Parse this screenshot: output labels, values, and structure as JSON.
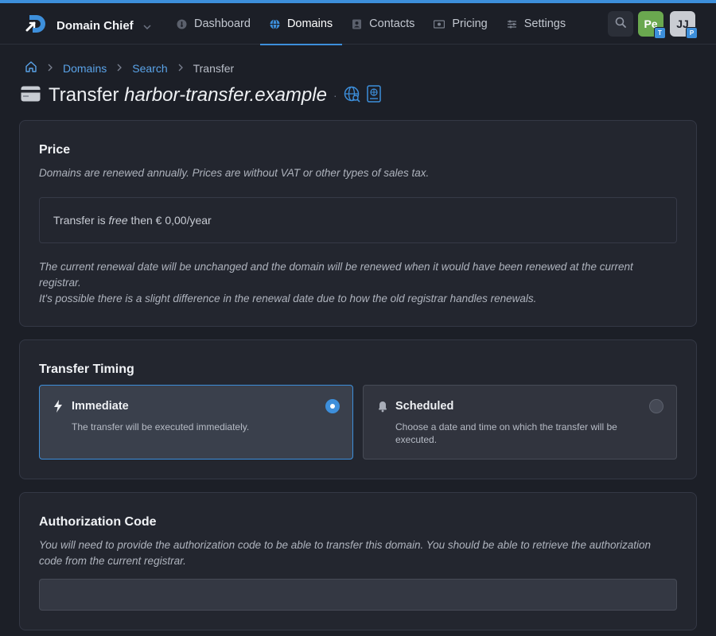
{
  "app": {
    "name": "Domain Chief",
    "accent": "#3d8fdb"
  },
  "nav": {
    "items": [
      {
        "label": "Dashboard",
        "icon": "dashboard-icon"
      },
      {
        "label": "Domains",
        "icon": "globe-icon",
        "active": true
      },
      {
        "label": "Contacts",
        "icon": "contacts-icon"
      },
      {
        "label": "Pricing",
        "icon": "pricing-icon"
      },
      {
        "label": "Settings",
        "icon": "settings-icon"
      }
    ]
  },
  "user": {
    "avatars": [
      {
        "initials": "Pe",
        "badge": "T",
        "color": "#6aa84f"
      },
      {
        "initials": "JJ",
        "badge": "P",
        "color": "#c9ccd2"
      }
    ]
  },
  "breadcrumb": {
    "items": [
      "Domains",
      "Search"
    ],
    "current": "Transfer"
  },
  "title": {
    "prefix": "Transfer",
    "domain": "harbor-transfer.example"
  },
  "price": {
    "heading": "Price",
    "description": "Domains are renewed annually. Prices are without VAT or other types of sales tax.",
    "box_before": "Transfer is ",
    "box_free": "free",
    "box_after": " then € 0,00/year",
    "note1": "The current renewal date will be unchanged and the domain will be renewed when it would have been renewed at the current registrar.",
    "note2": "It's possible there is a slight difference in the renewal date due to how the old registrar handles renewals."
  },
  "timing": {
    "heading": "Transfer Timing",
    "options": [
      {
        "title": "Immediate",
        "description": "The transfer will be executed immediately.",
        "icon": "lightning-icon",
        "selected": true
      },
      {
        "title": "Scheduled",
        "description": "Choose a date and time on which the transfer will be executed.",
        "icon": "alarm-icon",
        "selected": false
      }
    ]
  },
  "auth": {
    "heading": "Authorization Code",
    "description": "You will need to provide the authorization code to be able to transfer this domain. You should be able to retrieve the authorization code from the current registrar.",
    "value": ""
  }
}
